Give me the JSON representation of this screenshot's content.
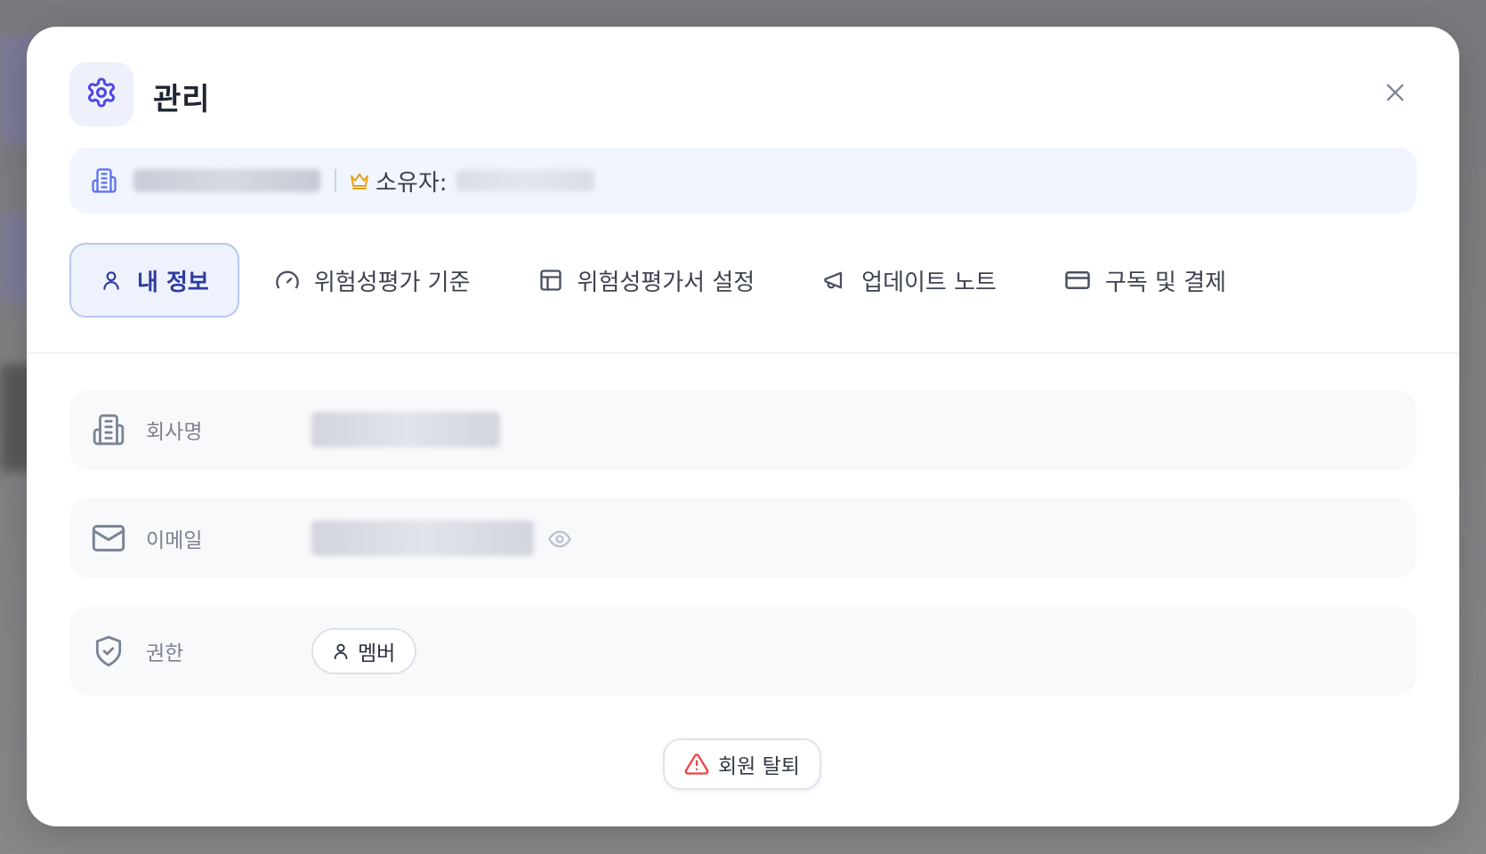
{
  "modal": {
    "title": "관리"
  },
  "org_bar": {
    "org_name_obscured": "",
    "owner_label": "소유자:",
    "owner_value_obscured": ""
  },
  "tabs": [
    {
      "label": "내 정보",
      "icon": "user-icon",
      "active": true
    },
    {
      "label": "위험성평가 기준",
      "icon": "gauge-icon",
      "active": false
    },
    {
      "label": "위험성평가서 설정",
      "icon": "table-icon",
      "active": false
    },
    {
      "label": "업데이트 노트",
      "icon": "megaphone-icon",
      "active": false
    },
    {
      "label": "구독 및 결제",
      "icon": "credit-card-icon",
      "active": false
    }
  ],
  "fields": {
    "company": {
      "label": "회사명",
      "icon": "building-icon",
      "value_obscured": ""
    },
    "email": {
      "label": "이메일",
      "icon": "mail-icon",
      "value_obscured": ""
    },
    "role": {
      "label": "권한",
      "icon": "shield-check-icon",
      "value": "멤버"
    }
  },
  "actions": {
    "withdraw_label": "회원 탈퇴"
  },
  "colors": {
    "accent": "#4f46e5",
    "owner_crown": "#e8a317",
    "danger": "#ef4444",
    "active_tab_bg": "#eef2fd"
  }
}
